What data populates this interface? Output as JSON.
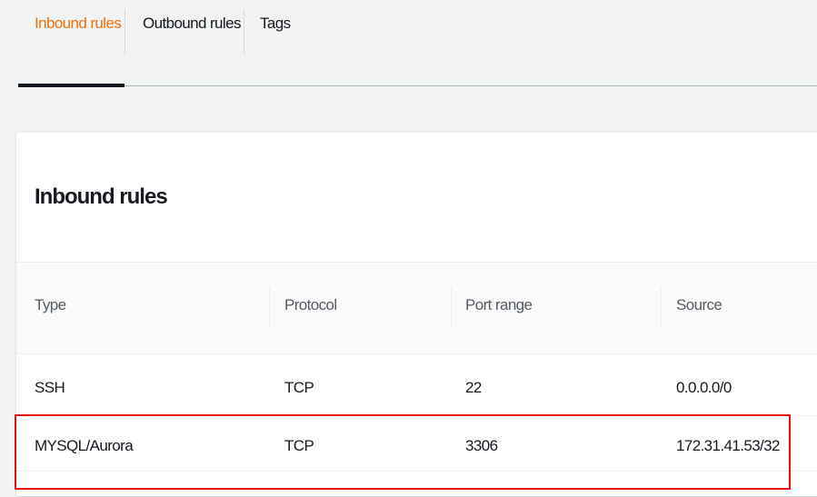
{
  "tabs": [
    {
      "label": "Inbound rules",
      "active": true
    },
    {
      "label": "Outbound rules",
      "active": false
    },
    {
      "label": "Tags",
      "active": false
    }
  ],
  "panel": {
    "title": "Inbound rules"
  },
  "table": {
    "columns": [
      "Type",
      "Protocol",
      "Port range",
      "Source"
    ],
    "rows": [
      [
        "SSH",
        "TCP",
        "22",
        "0.0.0.0/0"
      ],
      [
        "MYSQL/Aurora",
        "TCP",
        "3306",
        "172.31.41.53/32"
      ]
    ]
  },
  "colors": {
    "active_tab": "#ec7211",
    "highlight": "#e01010"
  }
}
